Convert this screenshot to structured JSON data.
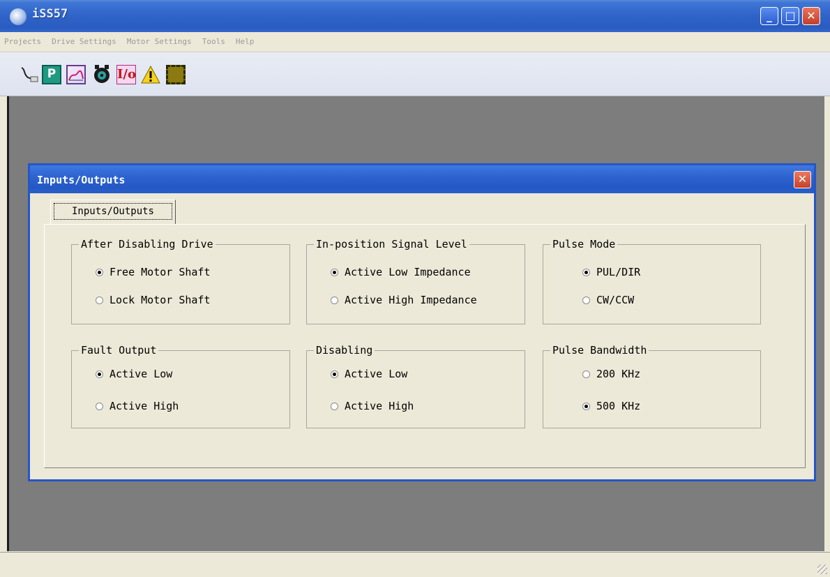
{
  "app": {
    "title": "iSS57"
  },
  "menu": [
    "Projects",
    "Drive Settings",
    "Motor Settings",
    "Tools",
    "Help"
  ],
  "toolbar": {
    "tools": [
      {
        "name": "cable-icon"
      },
      {
        "name": "p-icon",
        "glyph": "P"
      },
      {
        "name": "graph-icon"
      },
      {
        "name": "motor-icon"
      },
      {
        "name": "io-icon",
        "glyph": "I/o"
      },
      {
        "name": "warning-icon"
      },
      {
        "name": "chip-icon"
      }
    ]
  },
  "dialog": {
    "title": "Inputs/Outputs",
    "tab_label": "Inputs/Outputs",
    "groups": [
      {
        "title": "After Disabling Drive",
        "options": [
          {
            "label": "Free Motor Shaft",
            "checked": true
          },
          {
            "label": "Lock Motor Shaft",
            "checked": false
          }
        ]
      },
      {
        "title": "In-position Signal Level",
        "options": [
          {
            "label": "Active Low Impedance",
            "checked": true
          },
          {
            "label": "Active High Impedance",
            "checked": false
          }
        ]
      },
      {
        "title": "Pulse Mode",
        "options": [
          {
            "label": "PUL/DIR",
            "checked": true
          },
          {
            "label": "CW/CCW",
            "checked": false
          }
        ]
      },
      {
        "title": "Fault Output",
        "options": [
          {
            "label": "Active Low",
            "checked": true
          },
          {
            "label": "Active High",
            "checked": false
          }
        ]
      },
      {
        "title": "Disabling",
        "options": [
          {
            "label": "Active Low",
            "checked": true
          },
          {
            "label": "Active High",
            "checked": false
          }
        ]
      },
      {
        "title": "Pulse Bandwidth",
        "options": [
          {
            "label": "200 KHz",
            "checked": false
          },
          {
            "label": "500 KHz",
            "checked": true
          }
        ]
      }
    ]
  },
  "colors": {
    "titlebar": "#2f63c8",
    "workspace": "#7d7d7d",
    "dialog_border": "#2556c9",
    "panel": "#ece9d8"
  }
}
